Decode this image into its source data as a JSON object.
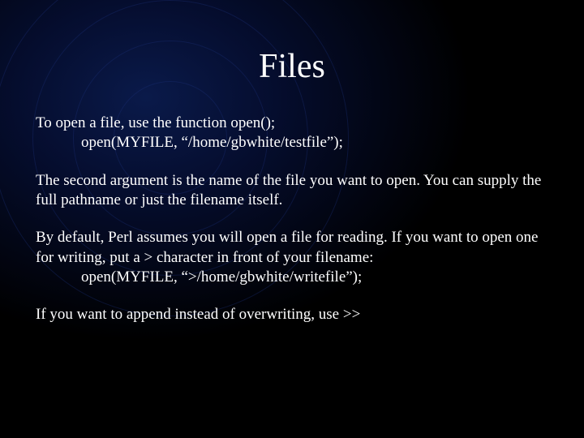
{
  "title": "Files",
  "p1_line1": "To open a file, use the function open();",
  "p1_line2": "open(MYFILE, “/home/gbwhite/testfile”);",
  "p2": "The second argument is the name of the file you want to open. You can supply the full pathname or just the filename itself.",
  "p3_part1": "By default, Perl assumes you will open a file for reading.  If you want to open one for writing, put a > character in front of your filename:",
  "p3_line4": "open(MYFILE, “>/home/gbwhite/writefile”);",
  "p4": "If you want to append instead of overwriting, use >>"
}
